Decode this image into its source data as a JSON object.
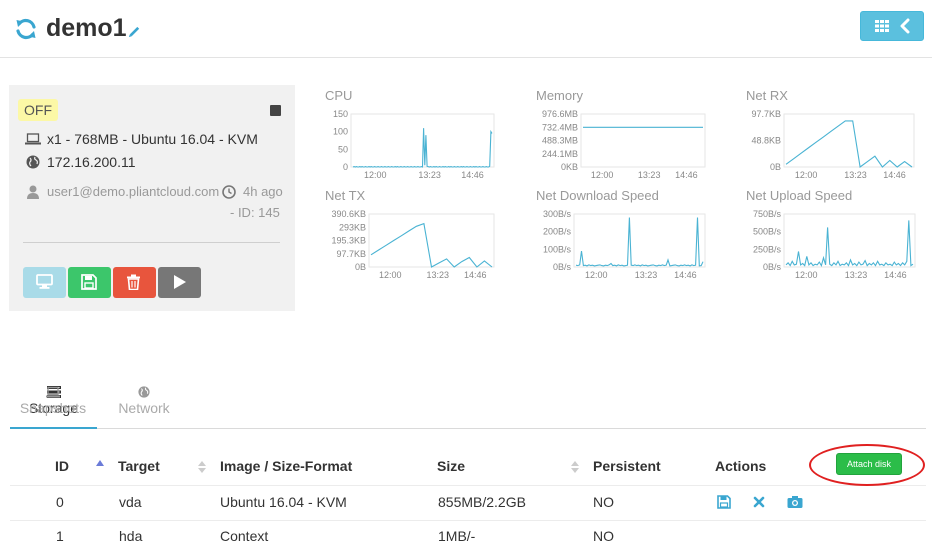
{
  "header": {
    "vm_name": "demo1"
  },
  "vm": {
    "state": "OFF",
    "spec": "x1 - 768MB - Ubuntu 16.04 - KVM",
    "ip": "172.16.200.11",
    "owner": "user1@demo.pliantcloud.com",
    "age": "4h ago",
    "id_text": "- ID: 145"
  },
  "colors": {
    "accent": "#3aa6d0",
    "chart_line": "#4ab3d3",
    "off_badge": "#fcf8a6",
    "vnc": "#a9dbe8",
    "save": "#3cc66b",
    "delete": "#e8553d",
    "play": "#777777",
    "attach": "#2bbd49"
  },
  "chart_data": [
    {
      "type": "line",
      "title": "CPU",
      "yticks": [
        "150",
        "100",
        "50",
        "0"
      ],
      "xticks": [
        "12:00",
        "13:23",
        "14:46"
      ],
      "ylim": [
        0,
        150
      ],
      "values": [
        0,
        1,
        0,
        1,
        0,
        0,
        1,
        0,
        1,
        0,
        0,
        1,
        0,
        0,
        1,
        0,
        1,
        0,
        0,
        1,
        0,
        0,
        1,
        0,
        0,
        1,
        0,
        0,
        1,
        0,
        0,
        1,
        0,
        0,
        1,
        0,
        0,
        1,
        0,
        1,
        0,
        0,
        1,
        0,
        0,
        1,
        0,
        0,
        1,
        0,
        0,
        1,
        0,
        0,
        1,
        0,
        0,
        1,
        0,
        0,
        1,
        0,
        110,
        5,
        90,
        2,
        1,
        0,
        1,
        0,
        0,
        1,
        0,
        1,
        0,
        0,
        1,
        0,
        0,
        1,
        0,
        1,
        0,
        0,
        1,
        0,
        1,
        0,
        0,
        1,
        0,
        0,
        1,
        0,
        0,
        1,
        0,
        1,
        0,
        0,
        1,
        0,
        0,
        1,
        0,
        0,
        1,
        0,
        1,
        0,
        0,
        1,
        0,
        0,
        1,
        0,
        0,
        1,
        0,
        0,
        2,
        100,
        95
      ]
    },
    {
      "type": "line",
      "title": "Memory",
      "yticks": [
        "976.6MB",
        "732.4MB",
        "488.3MB",
        "244.1MB",
        "0KB"
      ],
      "xticks": [
        "12:00",
        "13:23",
        "14:46"
      ],
      "ylim": [
        0,
        976.6
      ],
      "values": [
        732.4,
        732.4,
        732.4,
        732.4,
        732.4,
        732.4,
        732.4,
        732.4,
        732.4,
        732.4
      ]
    },
    {
      "type": "line",
      "title": "Net RX",
      "yticks": [
        "97.7KB",
        "48.8KB",
        "0B"
      ],
      "xticks": [
        "12:00",
        "13:23",
        "14:46"
      ],
      "ylim": [
        0,
        97.7
      ],
      "values": [
        5,
        15,
        25,
        35,
        45,
        55,
        65,
        75,
        85,
        85,
        0,
        10,
        20,
        0,
        12,
        0,
        10,
        0
      ]
    },
    {
      "type": "line",
      "title": "Net TX",
      "yticks": [
        "390.6KB",
        "293KB",
        "195.3KB",
        "97.7KB",
        "0B"
      ],
      "xticks": [
        "12:00",
        "13:23",
        "14:46"
      ],
      "ylim": [
        0,
        390.6
      ],
      "values": [
        90,
        125,
        160,
        195,
        230,
        265,
        300,
        320,
        0,
        30,
        60,
        0,
        40,
        70,
        0,
        45,
        0
      ]
    },
    {
      "type": "line",
      "title": "Net Download Speed",
      "yticks": [
        "300B/s",
        "200B/s",
        "100B/s",
        "0B/s"
      ],
      "xticks": [
        "12:00",
        "13:23",
        "14:46"
      ],
      "ylim": [
        0,
        300
      ],
      "values": [
        10,
        8,
        12,
        90,
        8,
        10,
        6,
        12,
        8,
        10,
        6,
        8,
        10,
        12,
        8,
        6,
        10,
        8,
        12,
        20,
        8,
        10,
        6,
        12,
        8,
        10,
        6,
        8,
        10,
        280,
        10,
        8,
        12,
        8,
        10,
        6,
        12,
        8,
        10,
        6,
        8,
        10,
        12,
        8,
        6,
        10,
        8,
        12,
        8,
        10,
        40,
        6,
        8,
        10,
        12,
        8,
        6,
        10,
        8,
        12,
        8,
        10,
        6,
        12,
        8,
        10,
        280,
        6,
        8,
        30
      ]
    },
    {
      "type": "line",
      "title": "Net Upload Speed",
      "yticks": [
        "750B/s",
        "500B/s",
        "250B/s",
        "0B/s"
      ],
      "xticks": [
        "12:00",
        "13:23",
        "14:46"
      ],
      "ylim": [
        0,
        750
      ],
      "values": [
        30,
        60,
        20,
        80,
        30,
        40,
        220,
        30,
        50,
        20,
        150,
        30,
        60,
        20,
        40,
        30,
        70,
        20,
        130,
        30,
        560,
        40,
        20,
        60,
        30,
        80,
        20,
        40,
        30,
        60,
        20,
        100,
        30,
        50,
        20,
        70,
        30,
        40,
        90,
        20,
        50,
        30,
        60,
        20,
        80,
        30,
        40,
        20,
        60,
        30,
        40,
        20,
        70,
        30,
        50,
        20,
        60,
        30,
        80,
        660,
        20,
        40
      ]
    }
  ],
  "tabs": [
    {
      "label": "Storage",
      "active": true,
      "icon": "hdd-icon"
    },
    {
      "label": "Network",
      "active": false,
      "icon": "globe-icon"
    },
    {
      "label": "Snapshots",
      "active": false,
      "icon": "laptop-icon"
    }
  ],
  "table": {
    "columns": [
      "ID",
      "Target",
      "Image / Size-Format",
      "Size",
      "Persistent",
      "Actions"
    ],
    "attach_label": "Attach disk",
    "rows": [
      {
        "id": "0",
        "target": "vda",
        "image": "Ubuntu 16.04 - KVM",
        "size": "855MB/2.2GB",
        "persistent": "NO",
        "actions": [
          "save-icon",
          "close-icon",
          "camera-icon"
        ]
      },
      {
        "id": "1",
        "target": "hda",
        "image": "Context",
        "size": "1MB/-",
        "persistent": "NO",
        "actions": []
      }
    ]
  }
}
